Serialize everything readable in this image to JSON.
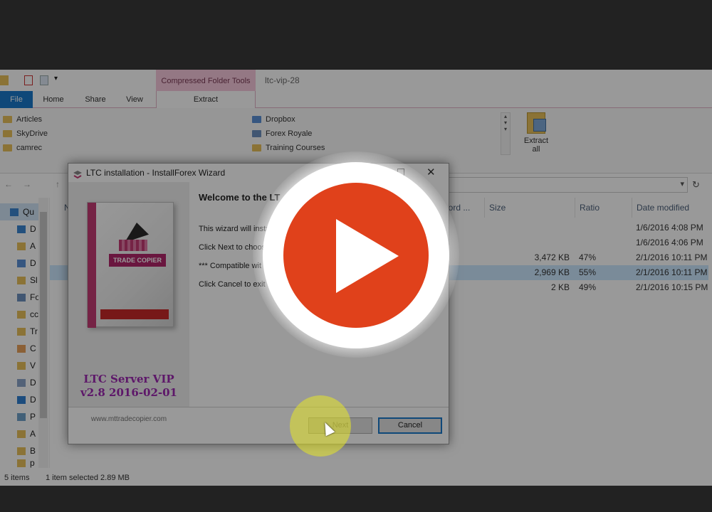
{
  "explorer": {
    "window_title": "ltc-vip-28",
    "context_tab": "Compressed Folder Tools",
    "tabs": [
      "File",
      "Home",
      "Share",
      "View",
      "Extract"
    ],
    "locations_left": [
      "Articles",
      "SkyDrive",
      "camrec"
    ],
    "locations_right": [
      "Dropbox",
      "Forex Royale",
      "Training Courses"
    ],
    "extract_all_line1": "Extract",
    "extract_all_line2": "all",
    "nav": {
      "quick_access": "Qu",
      "items": [
        "D",
        "A",
        "D",
        "Sl",
        "Fo",
        "cc",
        "Tr",
        "C",
        "V",
        "D",
        "D",
        "P",
        "A",
        "B",
        "p"
      ]
    },
    "columns": {
      "name": "N",
      "password": "word ...",
      "size": "Size",
      "ratio": "Ratio",
      "date": "Date modified"
    },
    "rows": [
      {
        "size": "",
        "ratio": "",
        "date": "1/6/2016 4:08 PM"
      },
      {
        "size": "",
        "ratio": "",
        "date": "1/6/2016 4:06 PM"
      },
      {
        "size": "3,472 KB",
        "ratio": "47%",
        "date": "2/1/2016 10:11 PM"
      },
      {
        "size": "2,969 KB",
        "ratio": "55%",
        "date": "2/1/2016 10:11 PM"
      },
      {
        "size": "2 KB",
        "ratio": "49%",
        "date": "2/1/2016 10:15 PM"
      }
    ],
    "status": {
      "count": "5 items",
      "selection": "1 item selected  2.89 MB"
    }
  },
  "dialog": {
    "title": "LTC installation - InstallForex Wizard",
    "close_glyph": "✕",
    "welcome": "Welcome to the LT",
    "lines": [
      "This wizard will insta",
      "Click Next to choos",
      "*** Compatible wit",
      "Click Cancel to exit"
    ],
    "product_name": "LTC Server VIP",
    "product_version": "v2.8 2016-02-01",
    "box_brand": "TRADE COPIER",
    "website": "www.mttradecopier.com",
    "next_label": "Next",
    "cancel_label": "Cancel"
  },
  "colors": {
    "file_tab": "#1979ca",
    "context_tab": "#f7c9dc",
    "play_button": "#e0411b",
    "product_text": "#9c27b0",
    "click_highlight": "#e6e628"
  },
  "icons": [
    "folder-icon",
    "dropbox-icon",
    "users-icon",
    "star-icon",
    "play-icon",
    "cursor-icon",
    "close-icon",
    "maximize-icon",
    "refresh-icon",
    "dropdown-icon"
  ]
}
